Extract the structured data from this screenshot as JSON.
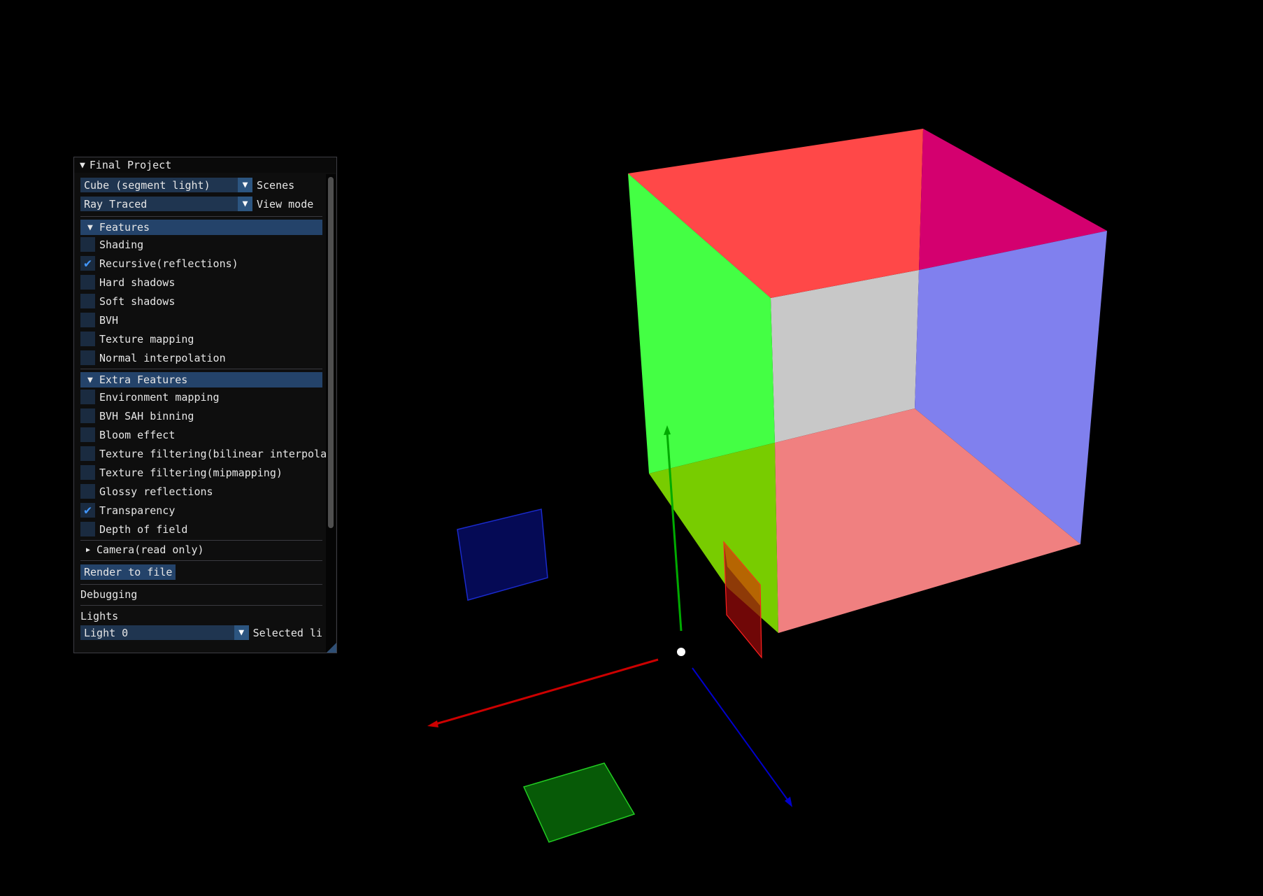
{
  "window": {
    "title": "Final Project",
    "collapse_icon": "triangle-down-icon"
  },
  "scene_select": {
    "value": "Cube (segment light)",
    "label": "Scenes"
  },
  "view_mode": {
    "value": "Ray Traced",
    "label": "View mode"
  },
  "features": {
    "header": "Features",
    "items": [
      {
        "label": "Shading",
        "checked": false
      },
      {
        "label": "Recursive(reflections)",
        "checked": true
      },
      {
        "label": "Hard shadows",
        "checked": false
      },
      {
        "label": "Soft shadows",
        "checked": false
      },
      {
        "label": "BVH",
        "checked": false
      },
      {
        "label": "Texture mapping",
        "checked": false
      },
      {
        "label": "Normal interpolation",
        "checked": false
      }
    ]
  },
  "extra_features": {
    "header": "Extra Features",
    "items": [
      {
        "label": "Environment mapping",
        "checked": false
      },
      {
        "label": "BVH SAH binning",
        "checked": false
      },
      {
        "label": "Bloom effect",
        "checked": false
      },
      {
        "label": "Texture filtering(bilinear interpolat",
        "checked": false
      },
      {
        "label": "Texture filtering(mipmapping)",
        "checked": false
      },
      {
        "label": "Glossy reflections",
        "checked": false
      },
      {
        "label": "Transparency",
        "checked": true
      },
      {
        "label": "Depth of field",
        "checked": false
      }
    ]
  },
  "camera_node": {
    "label": "Camera(read only)"
  },
  "render_button": {
    "label": "Render to file"
  },
  "debugging": {
    "label": "Debugging"
  },
  "lights": {
    "label": "Lights",
    "selected": {
      "value": "Light 0",
      "label": "Selected li"
    }
  },
  "colors": {
    "cube_top": "#ff4848",
    "cube_left": "#44ff44",
    "cube_back": "#c8c8c8",
    "cube_right": "#8080ee",
    "cube_top_right": "#d4006f",
    "cube_bottom": "#f08080",
    "cube_left_bottom": "#78cc00",
    "axis_x": "#cc0000",
    "axis_y": "#00aa00",
    "axis_z": "#0000cc",
    "checkmark": "#4296fa",
    "header_bg": "#24436a",
    "combo_bg": "#1f3550"
  }
}
